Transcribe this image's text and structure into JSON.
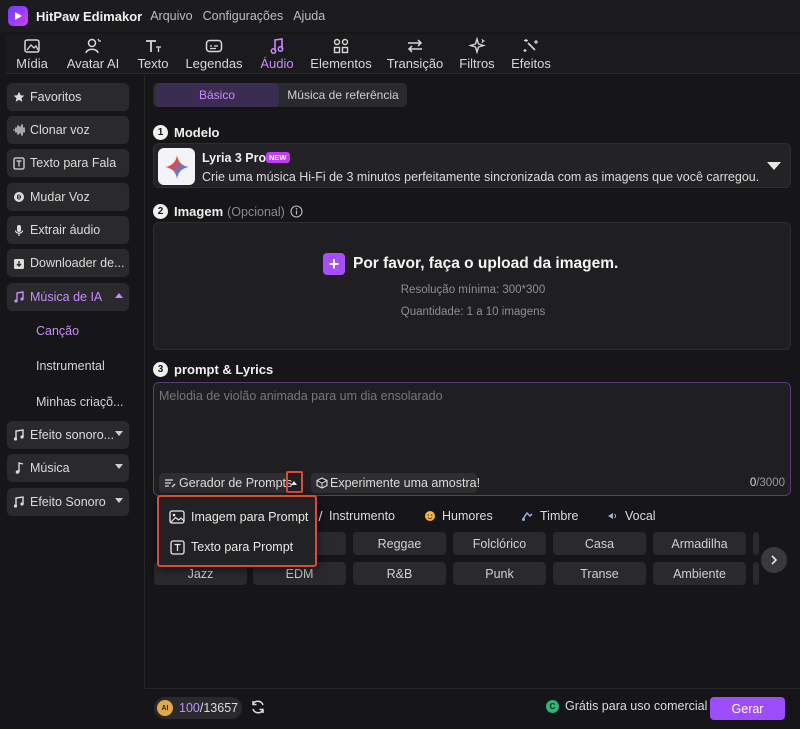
{
  "app": {
    "name": "HitPaw Edimakor",
    "menu": [
      "Arquivo",
      "Configurações",
      "Ajuda"
    ]
  },
  "toolbar": {
    "items": [
      {
        "label": "Mídia",
        "icon": "media-icon"
      },
      {
        "label": "Avatar AI",
        "icon": "avatar-icon"
      },
      {
        "label": "Texto",
        "icon": "text-icon"
      },
      {
        "label": "Legendas",
        "icon": "subtitles-icon"
      },
      {
        "label": "Áudio",
        "icon": "audio-icon",
        "active": true
      },
      {
        "label": "Elementos",
        "icon": "elements-icon"
      },
      {
        "label": "Transição",
        "icon": "transition-icon"
      },
      {
        "label": "Filtros",
        "icon": "filters-icon"
      },
      {
        "label": "Efeitos",
        "icon": "effects-icon"
      }
    ]
  },
  "sidebar": {
    "items": [
      {
        "label": "Favoritos",
        "icon": "star-icon"
      },
      {
        "label": "Clonar voz",
        "icon": "waveform-icon"
      },
      {
        "label": "Texto para Fala",
        "icon": "text-to-speech-icon"
      },
      {
        "label": "Mudar Voz",
        "icon": "voice-changer-icon"
      },
      {
        "label": "Extrair áudio",
        "icon": "microphone-icon"
      },
      {
        "label": "Downloader de...",
        "icon": "download-icon"
      },
      {
        "label": "Música de IA",
        "icon": "ai-music-icon",
        "active": true,
        "expanded": true
      },
      {
        "label": "Efeito sonoro...",
        "icon": "sound-effect-icon"
      },
      {
        "label": "Música",
        "icon": "music-note-icon"
      },
      {
        "label": "Efeito Sonoro",
        "icon": "sound-effect-icon"
      }
    ],
    "sub_items": [
      {
        "label": "Canção",
        "active": true
      },
      {
        "label": "Instrumental"
      },
      {
        "label": "Minhas criaçõ..."
      }
    ]
  },
  "tabs": [
    {
      "label": "Básico",
      "active": true
    },
    {
      "label": "Música de referência"
    }
  ],
  "model": {
    "section_label": "Modelo",
    "name": "Lyria 3 Pro",
    "badge": "NEW",
    "description": "Crie uma música Hi-Fi de 3 minutos perfeitamente sincronizada com as imagens que você carregou."
  },
  "image_section": {
    "label": "Imagem",
    "optional": "(Opcional)",
    "upload_title": "Por favor, faça o upload da imagem.",
    "resolution": "Resolução mínima: 300*300",
    "quantity": "Quantidade: 1 a 10 imagens"
  },
  "prompt_section": {
    "label": "prompt & Lyrics",
    "placeholder": "Melodia de violão animada para um dia ensolarado",
    "generator_label": "Gerador de Prompts",
    "sample_label": "Experimente uma amostra!",
    "count_current": "0",
    "count_max": "/3000"
  },
  "dropdown": {
    "items": [
      {
        "label": "Imagem para Prompt",
        "icon": "image-icon"
      },
      {
        "label": "Texto para Prompt",
        "icon": "text-box-icon"
      }
    ]
  },
  "categories": [
    {
      "label": "Instrumento",
      "icon": "instrument-icon"
    },
    {
      "label": "Humores",
      "icon": "mood-icon"
    },
    {
      "label": "Timbre",
      "icon": "timbre-icon"
    },
    {
      "label": "Vocal",
      "icon": "vocal-icon"
    }
  ],
  "genre_chips": {
    "row1": [
      "",
      "Reggae",
      "Folclórico",
      "Casa",
      "Armadilha"
    ],
    "row2": [
      "Jazz",
      "EDM",
      "R&B",
      "Punk",
      "Transe",
      "Ambiente"
    ]
  },
  "footer": {
    "credit_current": "100",
    "credit_total": "/13657",
    "coin_label": "AI",
    "free_label": "Grátis para uso comercial",
    "generate_label": "Gerar"
  },
  "colors": {
    "accent": "#9d4dff",
    "accent_text": "#c78bff",
    "highlight": "#e0483a",
    "free_badge": "#2bb673"
  }
}
